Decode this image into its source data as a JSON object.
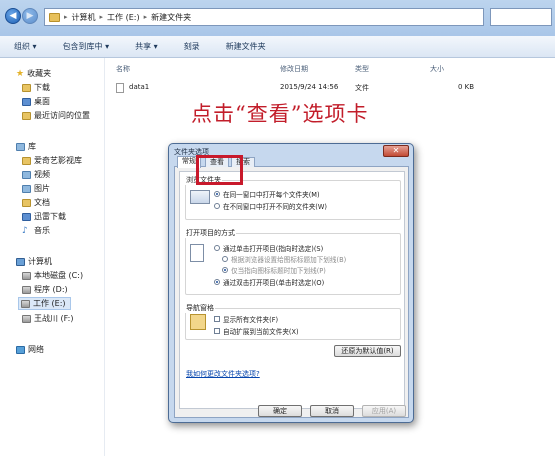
{
  "address_bar": {
    "crumbs": [
      "计算机",
      "工作 (E:)",
      "新建文件夹"
    ]
  },
  "toolbar": {
    "items": [
      "组织 ▾",
      "包含到库中 ▾",
      "共享 ▾",
      "刻录",
      "新建文件夹"
    ]
  },
  "sidebar": {
    "favorites": "收藏夹",
    "fav_items": [
      "下载",
      "桌面",
      "最近访问的位置"
    ],
    "libraries": "库",
    "lib_items": [
      "爱奇艺影视库",
      "视频",
      "图片",
      "文档",
      "迅雷下载",
      "音乐"
    ],
    "computer": "计算机",
    "drives": [
      "本地磁盘 (C:)",
      "程序 (D:)",
      "工作 (E:)",
      "王战川 (F:)"
    ],
    "network": "网络"
  },
  "file_list": {
    "columns": [
      "名称",
      "修改日期",
      "类型",
      "大小"
    ],
    "rows": [
      {
        "name": "data1",
        "modified": "2015/9/24 14:56",
        "type": "文件",
        "size": "0 KB"
      }
    ]
  },
  "annotation": "点击“查看”选项卡",
  "dialog": {
    "title": "文件夹选项",
    "tabs": [
      "常规",
      "查看",
      "搜索"
    ],
    "active_tab": "常规",
    "browse_group": {
      "label": "浏览文件夹",
      "options": [
        "在同一窗口中打开每个文件夹(M)",
        "在不同窗口中打开不同的文件夹(W)"
      ],
      "selected": 0
    },
    "open_group": {
      "label": "打开项目的方式",
      "options": [
        "通过单击打开项目(指向时选定)(S)",
        "根据浏览器设置给图标标题加下划线(B)",
        "仅当指向图标标题时加下划线(P)",
        "通过双击打开项目(单击时选定)(O)"
      ],
      "selected": 3
    },
    "nav_group": {
      "label": "导航窗格",
      "options": [
        "显示所有文件夹(F)",
        "自动扩展到当前文件夹(X)"
      ]
    },
    "restore_button": "还原为默认值(R)",
    "help_link": "我如何更改文件夹选项?",
    "ok": "确定",
    "cancel": "取消",
    "apply": "应用(A)",
    "highlight_color": "#c8192b"
  }
}
